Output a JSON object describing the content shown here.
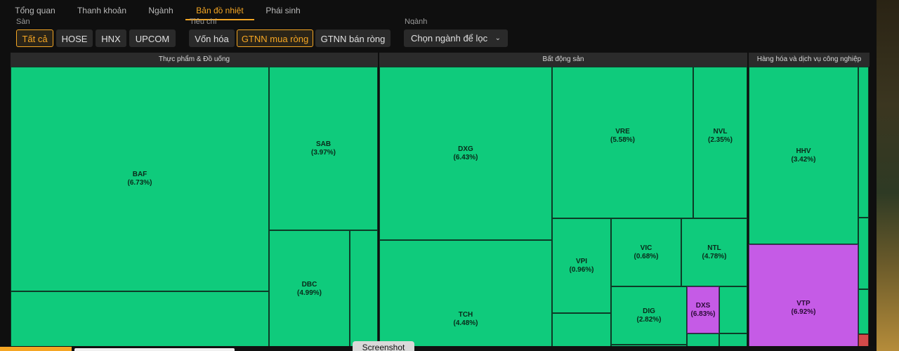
{
  "tabs": [
    {
      "label": "Tổng quan"
    },
    {
      "label": "Thanh khoản"
    },
    {
      "label": "Ngành"
    },
    {
      "label": "Bản đồ nhiệt"
    },
    {
      "label": "Phái sinh"
    }
  ],
  "active_tab": "Bản đồ nhiệt",
  "filters": {
    "exchange_label": "Sàn",
    "exchange_options": [
      "Tất cả",
      "HOSE",
      "HNX",
      "UPCOM"
    ],
    "exchange_selected": "Tất cả",
    "metric_label": "Tiêu chí",
    "metric_options": [
      "Vốn hóa",
      "GTNN mua ròng",
      "GTNN bán ròng"
    ],
    "metric_selected": "GTNN mua ròng",
    "industry_label": "Ngành",
    "industry_select": "Chọn ngành để lọc"
  },
  "sectors": [
    {
      "name": "Thực phẩm & Đồ uống"
    },
    {
      "name": "Bất động sản"
    },
    {
      "name": "Hàng hóa và dịch vụ công nghiệp"
    }
  ],
  "tiles": [
    {
      "ticker": "BAF",
      "pct": "(6.73%)"
    },
    {
      "ticker": "SAB",
      "pct": "(3.97%)"
    },
    {
      "ticker": "DBC",
      "pct": "(4.99%)"
    },
    {
      "ticker": "DXG",
      "pct": "(6.43%)"
    },
    {
      "ticker": "TCH",
      "pct": "(4.48%)"
    },
    {
      "ticker": "VRE",
      "pct": "(5.58%)"
    },
    {
      "ticker": "NVL",
      "pct": "(2.35%)"
    },
    {
      "ticker": "VPI",
      "pct": "(0.96%)"
    },
    {
      "ticker": "VIC",
      "pct": "(0.68%)"
    },
    {
      "ticker": "NTL",
      "pct": "(4.78%)"
    },
    {
      "ticker": "DIG",
      "pct": "(2.82%)"
    },
    {
      "ticker": "DXS",
      "pct": "(6.83%)"
    },
    {
      "ticker": "HHV",
      "pct": "(3.42%)"
    },
    {
      "ticker": "VTP",
      "pct": "(6.92%)"
    }
  ],
  "colors": {
    "up": "#0fcb7c",
    "ceiling": "#c55be6",
    "down": "#d34a4a",
    "accent": "#f5a623"
  },
  "screenshot_tip": "Screenshot"
}
